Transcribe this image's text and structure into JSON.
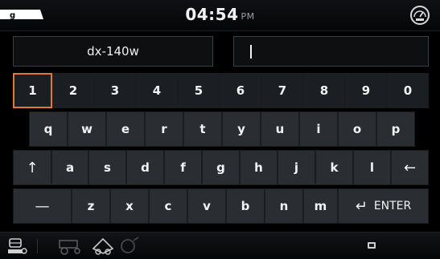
{
  "header": {
    "time": "04:54",
    "ampm": "PM",
    "icons": {
      "logo": "brand-logo-partial",
      "gauge": "gauge-icon"
    }
  },
  "inputs": {
    "model_value": "dx-140w",
    "entry_value": ""
  },
  "keyboard": {
    "row1": [
      "1",
      "2",
      "3",
      "4",
      "5",
      "6",
      "7",
      "8",
      "9",
      "0"
    ],
    "row2": [
      "q",
      "w",
      "e",
      "r",
      "t",
      "y",
      "u",
      "i",
      "o",
      "p"
    ],
    "row3": [
      "a",
      "s",
      "d",
      "f",
      "g",
      "h",
      "j",
      "k",
      "l"
    ],
    "row4": [
      "z",
      "x",
      "c",
      "v",
      "b",
      "n",
      "m"
    ],
    "shift_glyph": "↑",
    "backspace_glyph": "←",
    "dash_glyph": "—",
    "enter_glyph": "↵",
    "enter_label": "ENTER",
    "selected_key": "1"
  },
  "footer": {
    "icons": [
      "machine-icon",
      "tractor-icon",
      "implement-icon",
      "settings-icon",
      "sim-card-icon"
    ]
  },
  "colors": {
    "accent": "#e3792b",
    "key_bg": "#2a2e33",
    "num_key_bg": "#1b1e22",
    "screen_bg": "#000000"
  }
}
